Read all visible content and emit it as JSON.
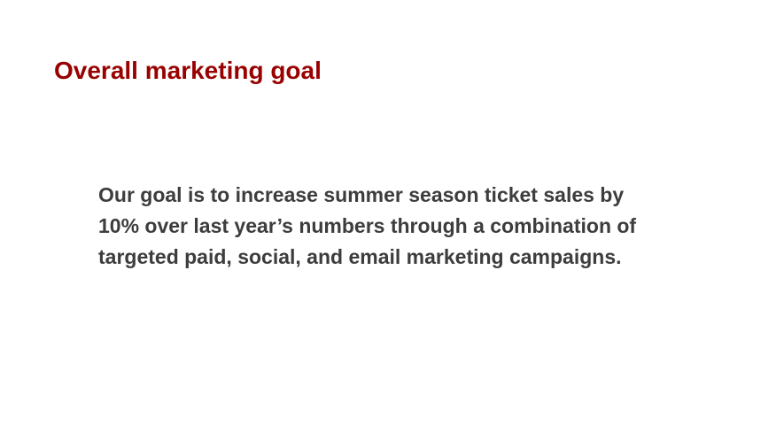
{
  "slide": {
    "title": "Overall marketing goal",
    "body_lines": [
      "Our goal is to increase summer season ticket sales by",
      "10% over last year’s numbers through a combination of",
      "targeted paid, social, and email marketing campaigns."
    ]
  },
  "colors": {
    "title": "#990000",
    "body_text": "#3d3d3d",
    "background": "#ffffff"
  }
}
